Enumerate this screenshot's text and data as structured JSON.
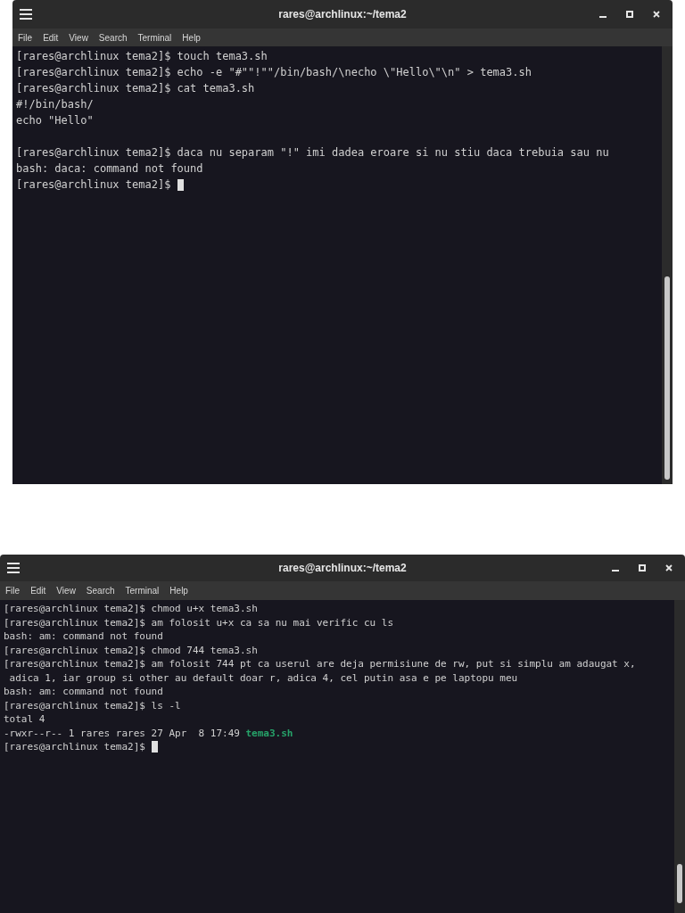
{
  "windows": [
    {
      "title": "rares@archlinux:~/tema2",
      "menu": [
        "File",
        "Edit",
        "View",
        "Search",
        "Terminal",
        "Help"
      ],
      "lines": [
        {
          "kind": "text",
          "text": "[rares@archlinux tema2]$ touch tema3.sh"
        },
        {
          "kind": "text",
          "text": "[rares@archlinux tema2]$ echo -e \"#\"\"!\"\"/bin/bash/\\necho \\\"Hello\\\"\\n\" > tema3.sh"
        },
        {
          "kind": "text",
          "text": "[rares@archlinux tema2]$ cat tema3.sh"
        },
        {
          "kind": "text",
          "text": "#!/bin/bash/"
        },
        {
          "kind": "text",
          "text": "echo \"Hello\""
        },
        {
          "kind": "blank"
        },
        {
          "kind": "text",
          "text": "[rares@archlinux tema2]$ daca nu separam \"!\" imi dadea eroare si nu stiu daca trebuia sau nu"
        },
        {
          "kind": "text",
          "text": "bash: daca: command not found"
        },
        {
          "kind": "cursor",
          "text": "[rares@archlinux tema2]$"
        }
      ]
    },
    {
      "title": "rares@archlinux:~/tema2",
      "menu": [
        "File",
        "Edit",
        "View",
        "Search",
        "Terminal",
        "Help"
      ],
      "lines": [
        {
          "kind": "text",
          "text": "[rares@archlinux tema2]$ chmod u+x tema3.sh"
        },
        {
          "kind": "text",
          "text": "[rares@archlinux tema2]$ am folosit u+x ca sa nu mai verific cu ls"
        },
        {
          "kind": "text",
          "text": "bash: am: command not found"
        },
        {
          "kind": "text",
          "text": "[rares@archlinux tema2]$ chmod 744 tema3.sh"
        },
        {
          "kind": "text",
          "text": "[rares@archlinux tema2]$ am folosit 744 pt ca userul are deja permisiune de rw, put si simplu am adaugat x,"
        },
        {
          "kind": "text",
          "text": " adica 1, iar group si other au default doar r, adica 4, cel putin asa e pe laptopu meu"
        },
        {
          "kind": "text",
          "text": "bash: am: command not found"
        },
        {
          "kind": "text",
          "text": "[rares@archlinux tema2]$ ls -l"
        },
        {
          "kind": "text",
          "text": "total 4"
        },
        {
          "kind": "file",
          "text": "-rwxr--r-- 1 rares rares 27 Apr  8 17:49",
          "file": "tema3.sh",
          "color": "#26a269"
        },
        {
          "kind": "cursor",
          "text": "[rares@archlinux tema2]$"
        }
      ]
    }
  ]
}
